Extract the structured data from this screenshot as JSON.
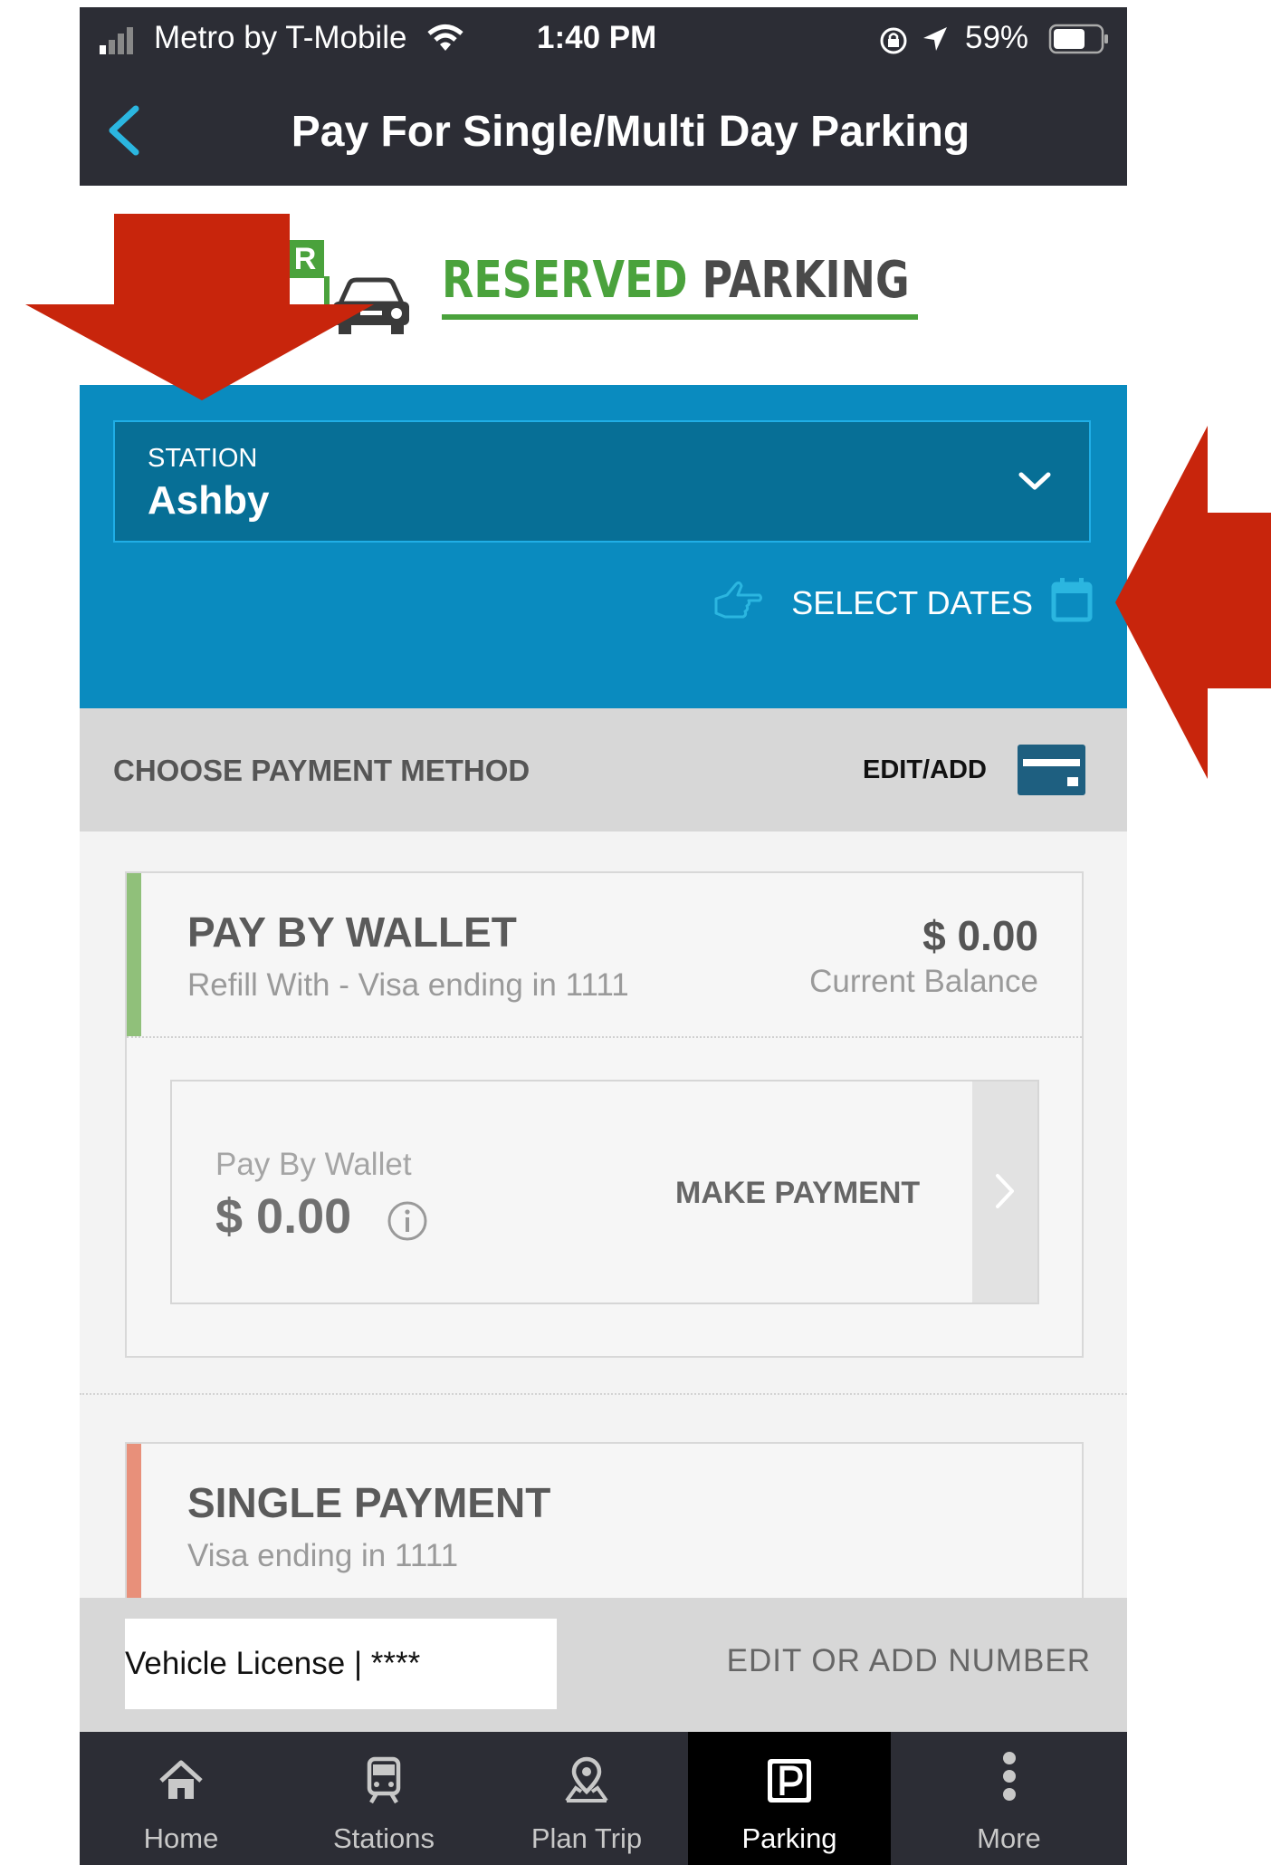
{
  "status_bar": {
    "carrier": "Metro by T-Mobile",
    "time": "1:40 PM",
    "battery": "59%"
  },
  "header": {
    "title": "Pay For Single/Multi Day Parking"
  },
  "logo": {
    "sign_letter": "R",
    "word_green": "RESERVED",
    "word_dark": "PARKING"
  },
  "station": {
    "label": "STATION",
    "value": "Ashby",
    "select_dates": "SELECT DATES"
  },
  "payment_method": {
    "title": "CHOOSE PAYMENT METHOD",
    "edit_add": "EDIT/ADD"
  },
  "wallet": {
    "title": "PAY BY WALLET",
    "refill": "Refill With - Visa ending in 1111",
    "balance": "$ 0.00",
    "balance_label": "Current Balance",
    "pay_label": "Pay By Wallet",
    "pay_amount": "$ 0.00",
    "make_payment": "MAKE PAYMENT"
  },
  "single_payment": {
    "title": "SINGLE PAYMENT",
    "subtitle": "Visa ending in 1111"
  },
  "vehicle": {
    "license": "Vehicle License | ****",
    "edit_number": "EDIT OR ADD NUMBER"
  },
  "tabs": [
    {
      "label": "Home",
      "icon": "home-icon"
    },
    {
      "label": "Stations",
      "icon": "train-icon"
    },
    {
      "label": "Plan Trip",
      "icon": "map-pin-icon"
    },
    {
      "label": "Parking",
      "icon": "parking-icon",
      "active": true
    },
    {
      "label": "More",
      "icon": "more-icon"
    }
  ],
  "colors": {
    "header_bg": "#2c2d35",
    "station_panel": "#0a8bbf",
    "station_select": "#076f96",
    "logo_green": "#4aa23c",
    "wallet_accent": "#90c07a",
    "single_accent": "#e8907a",
    "annotation_red": "#c8250c"
  }
}
